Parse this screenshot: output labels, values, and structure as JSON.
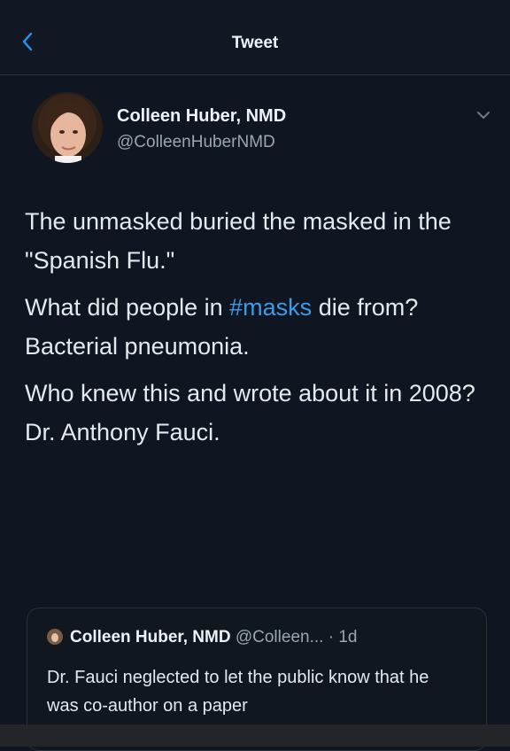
{
  "header": {
    "title": "Tweet",
    "back_icon": "chevron-left-icon",
    "accent_color": "#1d9bf0"
  },
  "tweet": {
    "author_name": "Colleen Huber, NMD",
    "author_handle": "@ColleenHuberNMD",
    "menu_icon": "chevron-down-icon",
    "lines": {
      "p1": "The unmasked buried the masked in the \"Spanish Flu.\"",
      "p2_before": "What did people in ",
      "p2_hashtag": "#masks",
      "p2_after": " die from?",
      "p3": "Bacterial pneumonia.",
      "p4": "Who knew this and wrote about it in 2008?",
      "p5": "Dr. Anthony Fauci."
    }
  },
  "quote": {
    "author_name": "Colleen Huber, NMD",
    "author_handle": "@Colleen...",
    "separator": " · ",
    "time": "1d",
    "text": "Dr. Fauci neglected to let the public know that he was co-author on a paper"
  }
}
